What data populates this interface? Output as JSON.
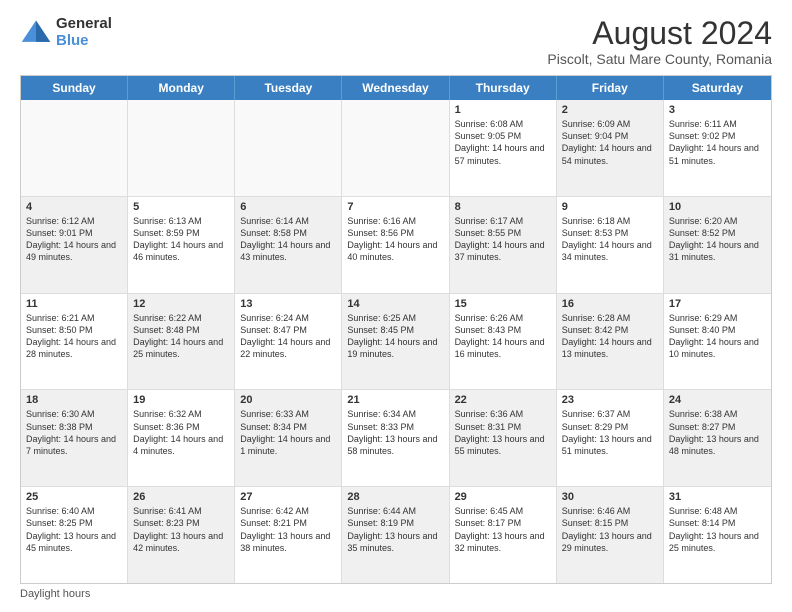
{
  "logo": {
    "general": "General",
    "blue": "Blue"
  },
  "title": "August 2024",
  "subtitle": "Piscolt, Satu Mare County, Romania",
  "calendar": {
    "headers": [
      "Sunday",
      "Monday",
      "Tuesday",
      "Wednesday",
      "Thursday",
      "Friday",
      "Saturday"
    ],
    "rows": [
      [
        {
          "day": "",
          "info": "",
          "empty": true
        },
        {
          "day": "",
          "info": "",
          "empty": true
        },
        {
          "day": "",
          "info": "",
          "empty": true
        },
        {
          "day": "",
          "info": "",
          "empty": true
        },
        {
          "day": "1",
          "info": "Sunrise: 6:08 AM\nSunset: 9:05 PM\nDaylight: 14 hours\nand 57 minutes."
        },
        {
          "day": "2",
          "info": "Sunrise: 6:09 AM\nSunset: 9:04 PM\nDaylight: 14 hours\nand 54 minutes.",
          "shaded": true
        },
        {
          "day": "3",
          "info": "Sunrise: 6:11 AM\nSunset: 9:02 PM\nDaylight: 14 hours\nand 51 minutes."
        }
      ],
      [
        {
          "day": "4",
          "info": "Sunrise: 6:12 AM\nSunset: 9:01 PM\nDaylight: 14 hours\nand 49 minutes.",
          "shaded": true
        },
        {
          "day": "5",
          "info": "Sunrise: 6:13 AM\nSunset: 8:59 PM\nDaylight: 14 hours\nand 46 minutes."
        },
        {
          "day": "6",
          "info": "Sunrise: 6:14 AM\nSunset: 8:58 PM\nDaylight: 14 hours\nand 43 minutes.",
          "shaded": true
        },
        {
          "day": "7",
          "info": "Sunrise: 6:16 AM\nSunset: 8:56 PM\nDaylight: 14 hours\nand 40 minutes."
        },
        {
          "day": "8",
          "info": "Sunrise: 6:17 AM\nSunset: 8:55 PM\nDaylight: 14 hours\nand 37 minutes.",
          "shaded": true
        },
        {
          "day": "9",
          "info": "Sunrise: 6:18 AM\nSunset: 8:53 PM\nDaylight: 14 hours\nand 34 minutes."
        },
        {
          "day": "10",
          "info": "Sunrise: 6:20 AM\nSunset: 8:52 PM\nDaylight: 14 hours\nand 31 minutes.",
          "shaded": true
        }
      ],
      [
        {
          "day": "11",
          "info": "Sunrise: 6:21 AM\nSunset: 8:50 PM\nDaylight: 14 hours\nand 28 minutes."
        },
        {
          "day": "12",
          "info": "Sunrise: 6:22 AM\nSunset: 8:48 PM\nDaylight: 14 hours\nand 25 minutes.",
          "shaded": true
        },
        {
          "day": "13",
          "info": "Sunrise: 6:24 AM\nSunset: 8:47 PM\nDaylight: 14 hours\nand 22 minutes."
        },
        {
          "day": "14",
          "info": "Sunrise: 6:25 AM\nSunset: 8:45 PM\nDaylight: 14 hours\nand 19 minutes.",
          "shaded": true
        },
        {
          "day": "15",
          "info": "Sunrise: 6:26 AM\nSunset: 8:43 PM\nDaylight: 14 hours\nand 16 minutes."
        },
        {
          "day": "16",
          "info": "Sunrise: 6:28 AM\nSunset: 8:42 PM\nDaylight: 14 hours\nand 13 minutes.",
          "shaded": true
        },
        {
          "day": "17",
          "info": "Sunrise: 6:29 AM\nSunset: 8:40 PM\nDaylight: 14 hours\nand 10 minutes."
        }
      ],
      [
        {
          "day": "18",
          "info": "Sunrise: 6:30 AM\nSunset: 8:38 PM\nDaylight: 14 hours\nand 7 minutes.",
          "shaded": true
        },
        {
          "day": "19",
          "info": "Sunrise: 6:32 AM\nSunset: 8:36 PM\nDaylight: 14 hours\nand 4 minutes."
        },
        {
          "day": "20",
          "info": "Sunrise: 6:33 AM\nSunset: 8:34 PM\nDaylight: 14 hours\nand 1 minute.",
          "shaded": true
        },
        {
          "day": "21",
          "info": "Sunrise: 6:34 AM\nSunset: 8:33 PM\nDaylight: 13 hours\nand 58 minutes."
        },
        {
          "day": "22",
          "info": "Sunrise: 6:36 AM\nSunset: 8:31 PM\nDaylight: 13 hours\nand 55 minutes.",
          "shaded": true
        },
        {
          "day": "23",
          "info": "Sunrise: 6:37 AM\nSunset: 8:29 PM\nDaylight: 13 hours\nand 51 minutes."
        },
        {
          "day": "24",
          "info": "Sunrise: 6:38 AM\nSunset: 8:27 PM\nDaylight: 13 hours\nand 48 minutes.",
          "shaded": true
        }
      ],
      [
        {
          "day": "25",
          "info": "Sunrise: 6:40 AM\nSunset: 8:25 PM\nDaylight: 13 hours\nand 45 minutes."
        },
        {
          "day": "26",
          "info": "Sunrise: 6:41 AM\nSunset: 8:23 PM\nDaylight: 13 hours\nand 42 minutes.",
          "shaded": true
        },
        {
          "day": "27",
          "info": "Sunrise: 6:42 AM\nSunset: 8:21 PM\nDaylight: 13 hours\nand 38 minutes."
        },
        {
          "day": "28",
          "info": "Sunrise: 6:44 AM\nSunset: 8:19 PM\nDaylight: 13 hours\nand 35 minutes.",
          "shaded": true
        },
        {
          "day": "29",
          "info": "Sunrise: 6:45 AM\nSunset: 8:17 PM\nDaylight: 13 hours\nand 32 minutes."
        },
        {
          "day": "30",
          "info": "Sunrise: 6:46 AM\nSunset: 8:15 PM\nDaylight: 13 hours\nand 29 minutes.",
          "shaded": true
        },
        {
          "day": "31",
          "info": "Sunrise: 6:48 AM\nSunset: 8:14 PM\nDaylight: 13 hours\nand 25 minutes."
        }
      ]
    ]
  },
  "footer": "Daylight hours"
}
